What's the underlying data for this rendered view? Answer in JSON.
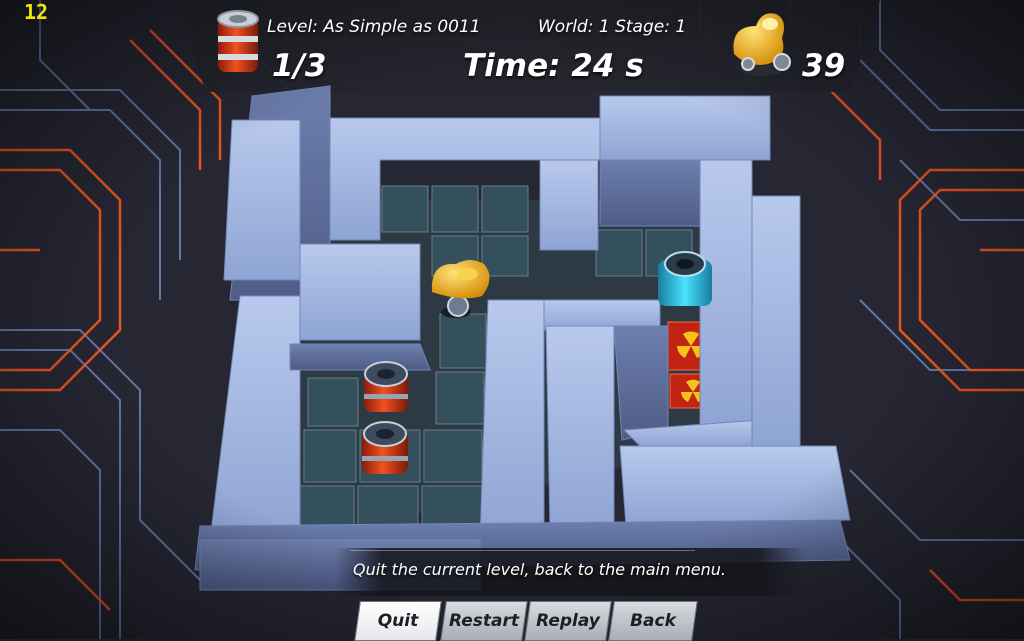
{
  "fps_counter": "12",
  "hud": {
    "level_label": "Level: As Simple as 0011",
    "world_stage": "World: 1 Stage: 1",
    "barrels": "1/3",
    "time": "Time: 24 s",
    "robot_count": "39"
  },
  "tooltip": "Quit the current level, back to the main menu.",
  "menu": {
    "buttons": [
      "Quit",
      "Restart",
      "Replay",
      "Back"
    ],
    "selected": "Quit"
  },
  "icons": {
    "barrel": "barrel-icon",
    "robot": "robot-icon",
    "radiation": "radiation-icon"
  },
  "colors": {
    "circuit_orange": "#ff5a1f",
    "circuit_blue": "#6d86b8",
    "wall_blue": "#9fb3dd",
    "barrel_red": "#e0431c",
    "goal_cyan": "#33d3f2",
    "robot_yellow": "#f4b81a",
    "hazard_red": "#c22413",
    "fps_yellow": "#f2e600"
  }
}
